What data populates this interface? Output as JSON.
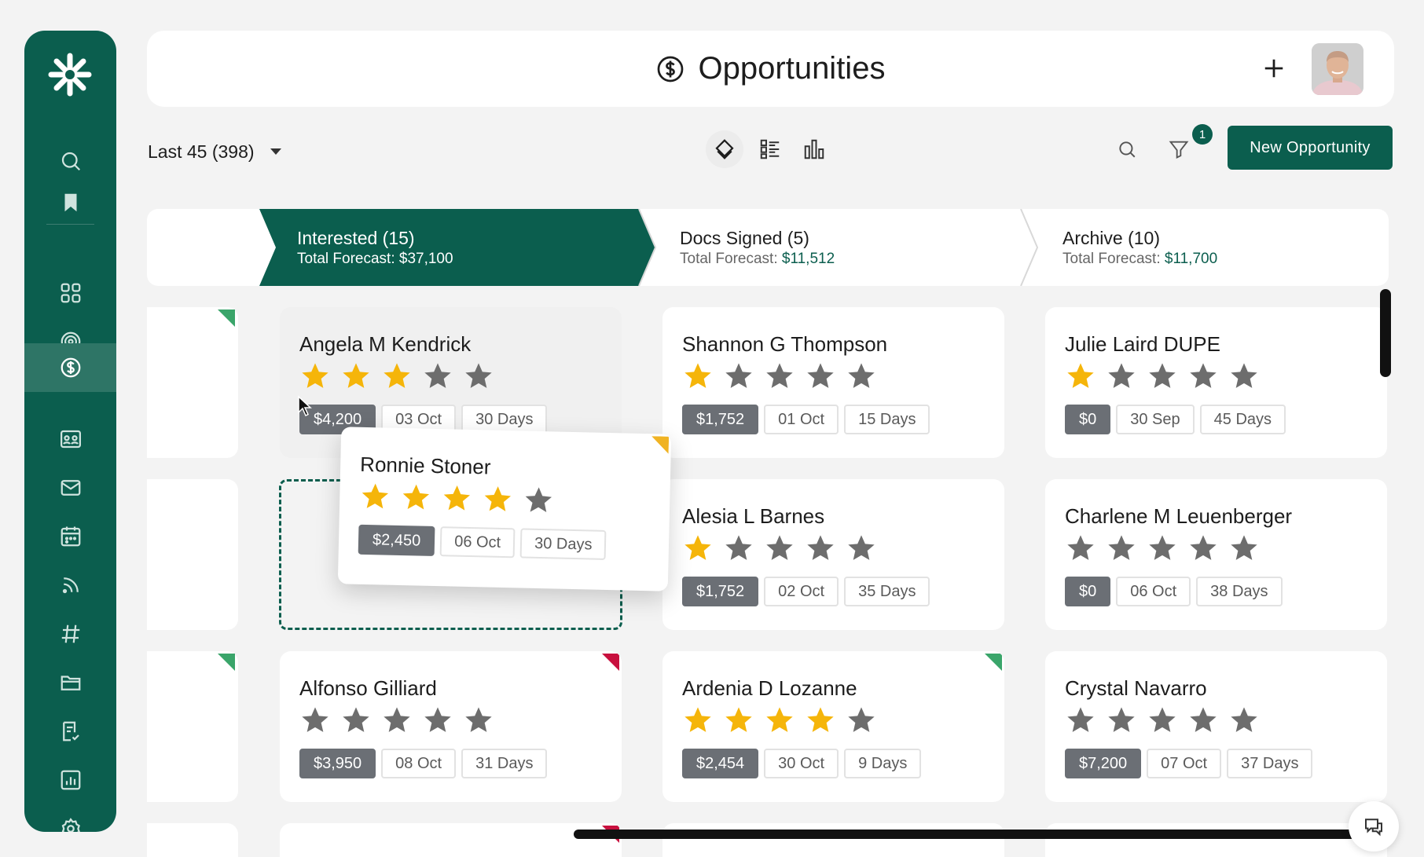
{
  "page": {
    "title": "Opportunities"
  },
  "colors": {
    "brand": "#0b5e4e",
    "star_on": "#f5b50a",
    "star_off": "#6d6d6d",
    "flag_green": "#3aa56a",
    "flag_red": "#c8103e",
    "flag_yellow": "#f0b323"
  },
  "sidebar": {
    "icons": [
      "search-icon",
      "bookmark-icon",
      "grid-icon",
      "target-icon",
      "dollar-icon",
      "contacts-icon",
      "mail-icon",
      "calendar-icon",
      "feed-icon",
      "hashtag-icon",
      "folder-icon",
      "checklist-icon",
      "report-icon",
      "settings-icon"
    ],
    "active": "dollar-icon"
  },
  "toolbar": {
    "filter_label": "Last 45 (398)",
    "filter_badge": "1",
    "new_button": "New Opportunity",
    "views": [
      "kanban-icon",
      "list-icon",
      "chart-icon"
    ]
  },
  "stages": [
    {
      "name": "Interested (15)",
      "forecast_label": "Total Forecast: ",
      "forecast_amount": "$37,100"
    },
    {
      "name": "Docs Signed (5)",
      "forecast_label": "Total Forecast: ",
      "forecast_amount": "$11,512"
    },
    {
      "name": "Archive (10)",
      "forecast_label": "Total Forecast: ",
      "forecast_amount": "$11,700"
    }
  ],
  "cards": {
    "c1": {
      "name": "Angela M Kendrick",
      "rating": 3,
      "amount": "$4,200",
      "date": "03 Oct",
      "days": "30 Days"
    },
    "c2": {
      "name": "Alfonso Gilliard",
      "rating": 0,
      "amount": "$3,950",
      "date": "08 Oct",
      "days": "31 Days"
    },
    "c3": {
      "name": "Shannon G Thompson",
      "rating": 1,
      "amount": "$1,752",
      "date": "01 Oct",
      "days": "15 Days"
    },
    "c4": {
      "name": "Alesia L Barnes",
      "rating": 1,
      "amount": "$1,752",
      "date": "02 Oct",
      "days": "35 Days"
    },
    "c5": {
      "name": "Ardenia D Lozanne",
      "rating": 4,
      "amount": "$2,454",
      "date": "30 Oct",
      "days": "9 Days"
    },
    "c6": {
      "name": "Julie Laird DUPE",
      "rating": 1,
      "amount": "$0",
      "date": "30 Sep",
      "days": "45 Days"
    },
    "c7": {
      "name": "Charlene M Leuenberger",
      "rating": 0,
      "amount": "$0",
      "date": "06 Oct",
      "days": "38 Days"
    },
    "c8": {
      "name": "Crystal Navarro",
      "rating": 0,
      "amount": "$7,200",
      "date": "07 Oct",
      "days": "37 Days"
    },
    "drag": {
      "name": "Ronnie Stoner",
      "rating": 4,
      "amount": "$2,450",
      "date": "06 Oct",
      "days": "30 Days"
    }
  }
}
